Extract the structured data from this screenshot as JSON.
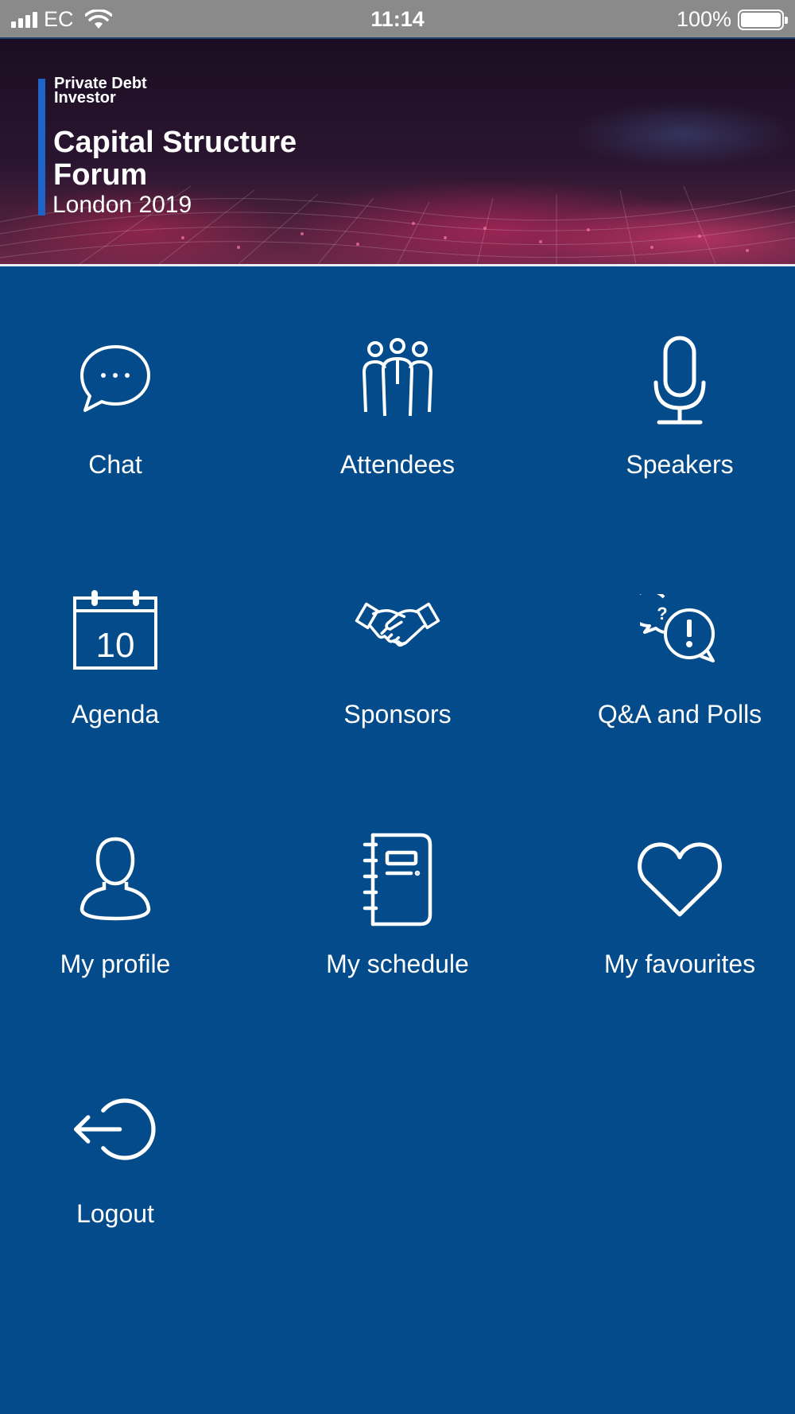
{
  "status_bar": {
    "carrier": "EC",
    "time": "11:14",
    "battery": "100%"
  },
  "banner": {
    "brand": "Private Debt Investor",
    "title": "Capital Structure Forum",
    "subtitle": "London 2019"
  },
  "menu": {
    "items": [
      {
        "label": "Chat",
        "icon": "chat-bubble-icon"
      },
      {
        "label": "Attendees",
        "icon": "people-group-icon"
      },
      {
        "label": "Speakers",
        "icon": "microphone-icon"
      },
      {
        "label": "Agenda",
        "icon": "calendar-icon",
        "calendar_day": "10"
      },
      {
        "label": "Sponsors",
        "icon": "handshake-icon"
      },
      {
        "label": "Q&A and Polls",
        "icon": "question-exclamation-bubbles-icon"
      },
      {
        "label": "My profile",
        "icon": "user-icon"
      },
      {
        "label": "My schedule",
        "icon": "notebook-icon"
      },
      {
        "label": "My favourites",
        "icon": "heart-icon"
      },
      {
        "label": "Logout",
        "icon": "logout-arrow-icon"
      }
    ]
  },
  "colors": {
    "background": "#034b8a",
    "status_bar": "#8a8a8a",
    "accent": "#1e64c8"
  }
}
